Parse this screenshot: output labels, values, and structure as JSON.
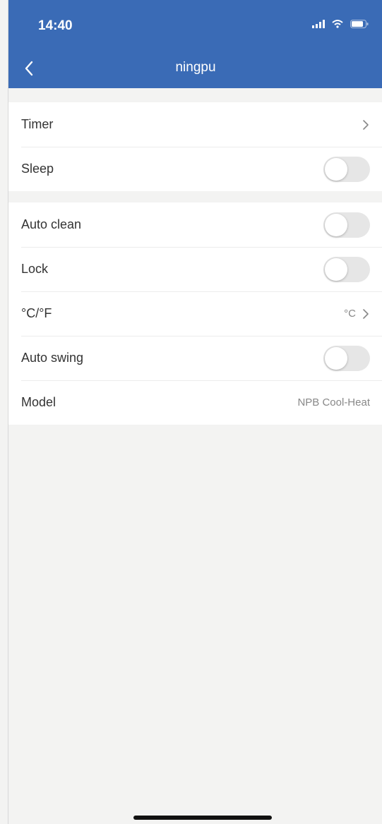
{
  "status_bar": {
    "time": "14:40"
  },
  "header": {
    "title": "ningpu",
    "back_icon": "chevron-left-icon",
    "background_color": "#3a6bb6"
  },
  "settings_group_1": [
    {
      "label": "Timer",
      "control": "chevron"
    },
    {
      "label": "Sleep",
      "control": "toggle",
      "on": false
    }
  ],
  "settings_group_2": [
    {
      "label": "Auto clean",
      "control": "toggle",
      "on": false
    },
    {
      "label": "Lock",
      "control": "toggle",
      "on": false
    },
    {
      "label": "°C/°F",
      "control": "value-chevron",
      "value": "°C"
    },
    {
      "label": "Auto swing",
      "control": "toggle",
      "on": false
    },
    {
      "label": "Model",
      "control": "value",
      "value": "NPB Cool-Heat"
    }
  ]
}
